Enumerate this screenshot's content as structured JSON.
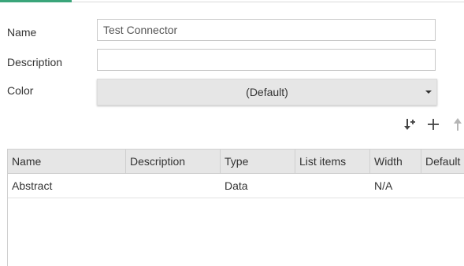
{
  "form": {
    "name_label": "Name",
    "name_value": "Test Connector",
    "description_label": "Description",
    "description_value": "",
    "color_label": "Color",
    "color_value": "(Default)"
  },
  "toolbar": {
    "icons": [
      "sort-add-icon",
      "plus-icon",
      "arrow-up-icon"
    ]
  },
  "table": {
    "columns": [
      "Name",
      "Description",
      "Type",
      "List items",
      "Width",
      "Default"
    ],
    "rows": [
      [
        "Abstract",
        "",
        "Data",
        "",
        "N/A",
        ""
      ]
    ]
  },
  "colors": {
    "accent": "#3aa57a",
    "header_bg": "#e6e6e6",
    "select_bg": "#e6e6e6"
  }
}
